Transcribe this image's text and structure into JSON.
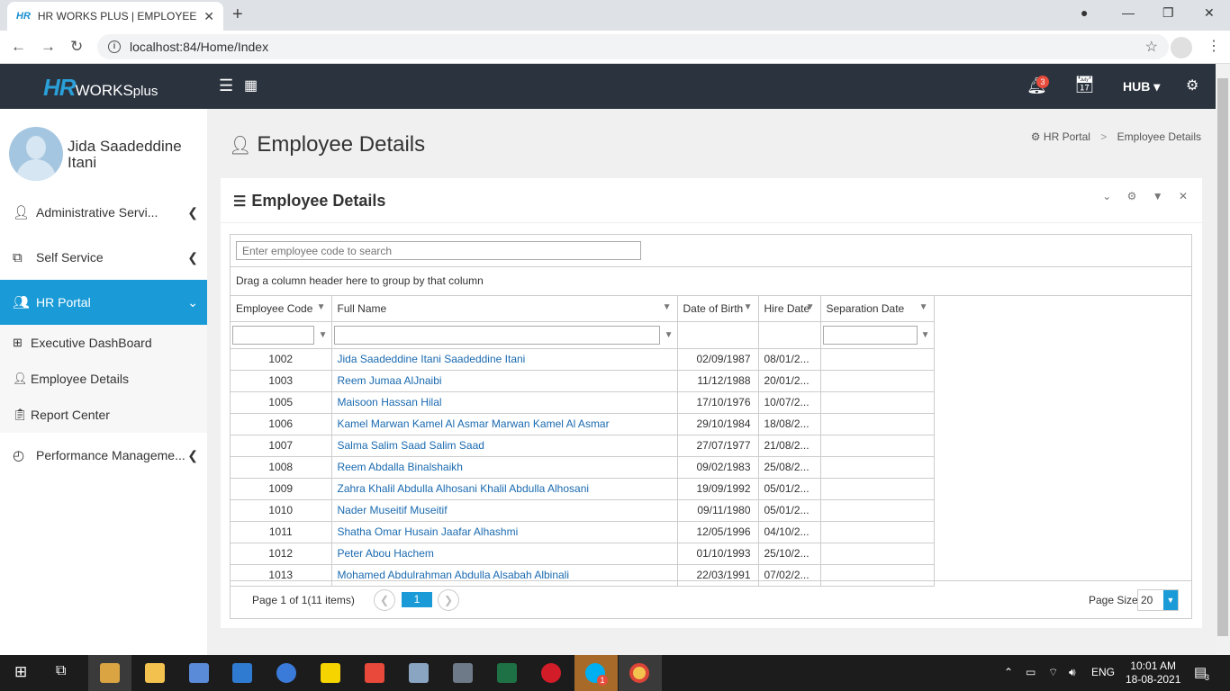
{
  "browser": {
    "tab_title": "HR WORKS PLUS | EMPLOYEE SE",
    "tab_favicon": "HR",
    "url": "localhost:84/Home/Index"
  },
  "header": {
    "logo_hr": "HR",
    "logo_works": "WORKS",
    "logo_plus": "plus",
    "notification_count": "3",
    "hub_label": "HUB"
  },
  "sidebar": {
    "user_name": "Jida Saadeddine Itani",
    "items": [
      {
        "label": "Administrative Servi...",
        "icon": "user-icon"
      },
      {
        "label": "Self Service",
        "icon": "self-service-icon"
      },
      {
        "label": "HR Portal",
        "icon": "hr-portal-icon"
      },
      {
        "label": "Performance Manageme...",
        "icon": "performance-icon"
      }
    ],
    "sub_items": [
      {
        "label": "Executive DashBoard",
        "icon": "dashboard-icon"
      },
      {
        "label": "Employee Details",
        "icon": "person-icon"
      },
      {
        "label": "Report Center",
        "icon": "report-icon"
      }
    ]
  },
  "page": {
    "title": "Employee Details",
    "breadcrumb_1": "HR Portal",
    "breadcrumb_sep": ">",
    "breadcrumb_2": "Employee Details"
  },
  "panel": {
    "title": "Employee Details",
    "search_placeholder": "Enter employee code to search",
    "group_hint": "Drag a column header here to group by that column"
  },
  "grid": {
    "columns": [
      "Employee Code",
      "Full Name",
      "Date of Birth",
      "Hire Date",
      "Separation Date"
    ],
    "rows": [
      {
        "code": "1002",
        "name": "Jida Saadeddine Itani Saadeddine Itani",
        "dob": "02/09/1987",
        "hire": "08/01/2..."
      },
      {
        "code": "1003",
        "name": "Reem Jumaa AlJnaibi",
        "dob": "11/12/1988",
        "hire": "20/01/2..."
      },
      {
        "code": "1005",
        "name": "Maisoon Hassan Hilal",
        "dob": "17/10/1976",
        "hire": "10/07/2..."
      },
      {
        "code": "1006",
        "name": "Kamel Marwan Kamel Al Asmar Marwan Kamel Al Asmar",
        "dob": "29/10/1984",
        "hire": "18/08/2..."
      },
      {
        "code": "1007",
        "name": "Salma Salim Saad Salim Saad",
        "dob": "27/07/1977",
        "hire": "21/08/2..."
      },
      {
        "code": "1008",
        "name": "Reem Abdalla Binalshaikh",
        "dob": "09/02/1983",
        "hire": "25/08/2..."
      },
      {
        "code": "1009",
        "name": "Zahra Khalil Abdulla Alhosani Khalil Abdulla Alhosani",
        "dob": "19/09/1992",
        "hire": "05/01/2..."
      },
      {
        "code": "1010",
        "name": "Nader Museitif Museitif",
        "dob": "09/11/1980",
        "hire": "05/01/2..."
      },
      {
        "code": "1011",
        "name": "Shatha Omar Husain Jaafar Alhashmi",
        "dob": "12/05/1996",
        "hire": "04/10/2..."
      },
      {
        "code": "1012",
        "name": "Peter Abou Hachem",
        "dob": "01/10/1993",
        "hire": "25/10/2..."
      },
      {
        "code": "1013",
        "name": "Mohamed Abdulrahman Abdulla Alsabah Albinali",
        "dob": "22/03/1991",
        "hire": "07/02/2..."
      }
    ],
    "pager_info": "Page 1 of 1(11 items)",
    "current_page": "1",
    "page_size_label": "Page Size",
    "page_size": "20"
  },
  "taskbar": {
    "language": "ENG",
    "time": "10:01 AM",
    "date": "18-08-2021",
    "notifications": "3",
    "skype_badge": "1"
  },
  "colors": {
    "header_bg": "#2b333e",
    "accent": "#1a9bd7",
    "link": "#1a6ab0"
  }
}
